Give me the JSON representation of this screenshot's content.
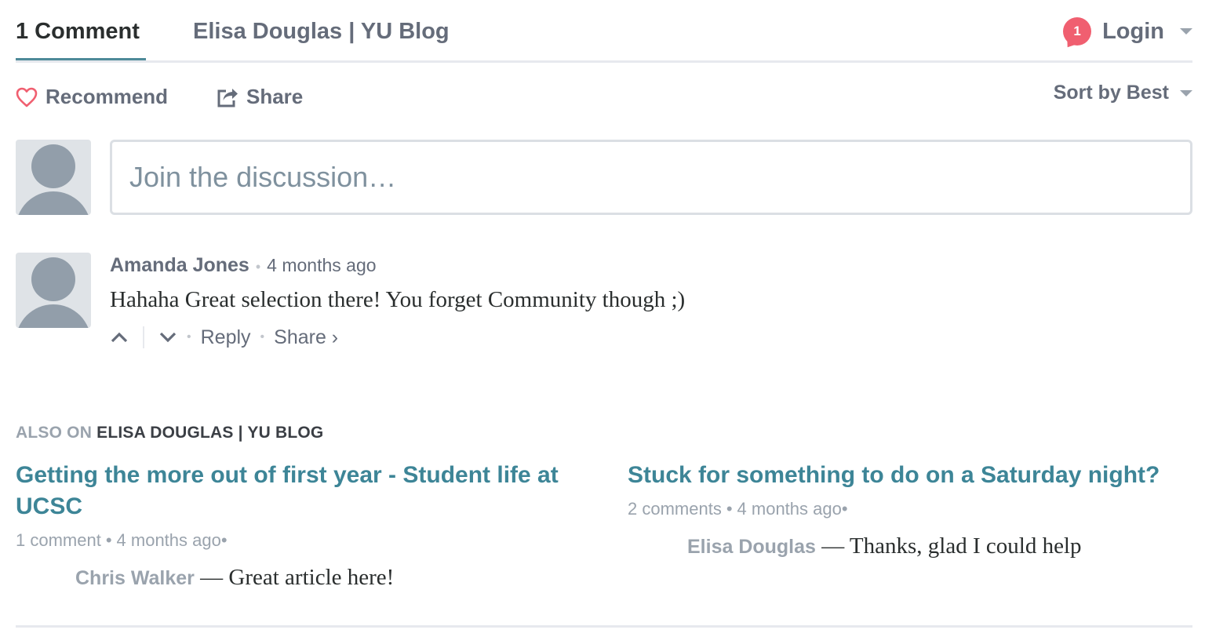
{
  "nav": {
    "comments_tab": "1 Comment",
    "community_tab": "Elisa Douglas | YU Blog",
    "notification_count": "1",
    "login_label": "Login"
  },
  "actions": {
    "recommend_label": "Recommend",
    "share_label": "Share",
    "sort_label": "Sort by Best"
  },
  "composer": {
    "placeholder": "Join the discussion…"
  },
  "comment": {
    "author": "Amanda Jones",
    "time": "4 months ago",
    "body": "Hahaha Great selection there! You forget Community though ;)",
    "reply_label": "Reply",
    "share_label": "Share ›"
  },
  "also_on": {
    "prefix": "ALSO ON ",
    "site": "ELISA DOUGLAS | YU BLOG",
    "items": [
      {
        "title": "Getting the more out of first year - Student life at UCSC",
        "comments": "1 comment",
        "time": "4 months ago",
        "snippet_author": "Chris Walker",
        "snippet_text": " — Great article here!"
      },
      {
        "title": "Stuck for something to do on a Saturday night?",
        "comments": "2 comments",
        "time": "4 months ago",
        "snippet_author": "Elisa Douglas",
        "snippet_text": " — Thanks, glad I could help"
      }
    ]
  },
  "colors": {
    "accent_link": "#3d8597",
    "badge": "#f05f70",
    "muted_text": "#656c7a"
  },
  "icons": [
    "heart-icon",
    "share-icon",
    "caret-down-icon",
    "upvote-icon",
    "downvote-icon",
    "avatar-placeholder-icon"
  ]
}
